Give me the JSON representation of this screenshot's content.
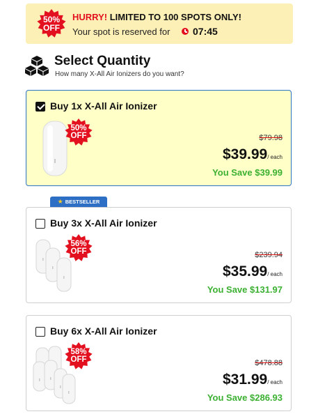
{
  "banner": {
    "badge": [
      "50%",
      "OFF"
    ],
    "hurry_prefix": "HURRY!",
    "hurry_text": " LIMITED TO 100 SPOTS ONLY!",
    "reserved_text": "Your spot is reserved for",
    "timer": "07:45",
    "clock_icon": "clock-icon"
  },
  "quantity": {
    "title": "Select Quantity",
    "subtitle": "How many X-All Air Ionizers do you want?",
    "icon": "cubes-icon"
  },
  "bestseller": {
    "label": "BESTSELLER",
    "icon": "star-icon"
  },
  "options": [
    {
      "name": "Buy 1x X-All Air Ionizer",
      "checked": true,
      "badge": [
        "50%",
        "OFF"
      ],
      "old_price": "$79.98",
      "price": "$39.99",
      "per": "/ each",
      "save": "You Save $39.99"
    },
    {
      "name": "Buy 3x X-All Air Ionizer",
      "checked": false,
      "badge": [
        "56%",
        "OFF"
      ],
      "old_price": "$239.94",
      "price": "$35.99",
      "per": "/ each",
      "save": "You Save $131.97"
    },
    {
      "name": "Buy 6x X-All Air Ionizer",
      "checked": false,
      "badge": [
        "58%",
        "OFF"
      ],
      "old_price": "$478.88",
      "price": "$31.99",
      "per": "/ each",
      "save": "You Save $286.93"
    }
  ],
  "colors": {
    "banner_bg": "#fdf0b6",
    "alert_red": "#e3111f",
    "save_green": "#3bb031",
    "selected_bg": "#ffffc8",
    "selected_border": "#2a73c6",
    "bestseller_blue": "#2d6fc4"
  }
}
